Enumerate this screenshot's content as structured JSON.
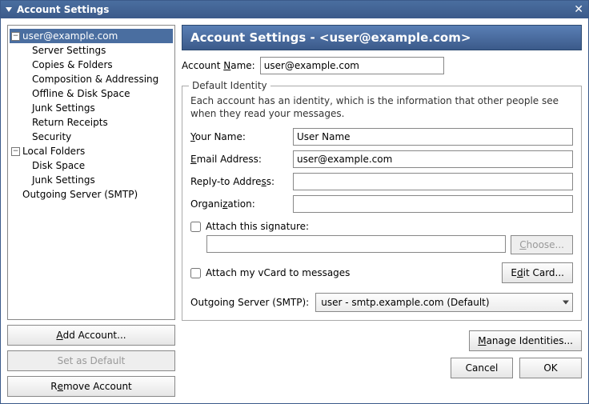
{
  "window": {
    "title": "Account Settings"
  },
  "tree": {
    "account": {
      "label": "user@example.com",
      "children": [
        "Server Settings",
        "Copies & Folders",
        "Composition & Addressing",
        "Offline & Disk Space",
        "Junk Settings",
        "Return Receipts",
        "Security"
      ]
    },
    "local": {
      "label": "Local Folders",
      "children": [
        "Disk Space",
        "Junk Settings"
      ]
    },
    "smtp": "Outgoing Server (SMTP)"
  },
  "left_buttons": {
    "add": {
      "pre": "",
      "mn": "A",
      "post": "dd Account..."
    },
    "default": "Set as Default",
    "remove": {
      "pre": "R",
      "mn": "e",
      "post": "move Account"
    }
  },
  "panel": {
    "title_prefix": "Account Settings - ",
    "title_account": "<user@example.com>",
    "account_name_label": {
      "pre": "Account ",
      "mn": "N",
      "post": "ame:"
    },
    "account_name_value": "user@example.com"
  },
  "identity": {
    "legend": "Default Identity",
    "desc": "Each account has an identity, which is the information that other people see when they read your messages.",
    "your_name": {
      "label": {
        "pre": "",
        "mn": "Y",
        "post": "our Name:"
      },
      "value": "User Name"
    },
    "email": {
      "label": {
        "pre": "",
        "mn": "E",
        "post": "mail Address:"
      },
      "value": "user@example.com"
    },
    "reply_to": {
      "label": {
        "pre": "Reply-to Addre",
        "mn": "s",
        "post": "s:"
      },
      "value": ""
    },
    "organization": {
      "label": {
        "pre": "Organi",
        "mn": "z",
        "post": "ation:"
      },
      "value": ""
    },
    "attach_sig": {
      "pre": "Attach this si",
      "mn": "g",
      "post": "nature:"
    },
    "sig_path": "",
    "choose": {
      "pre": "",
      "mn": "C",
      "post": "hoose..."
    },
    "attach_vcard": {
      "pre": "Attach my ",
      "mn": "v",
      "post": "Card to messages"
    },
    "edit_card": {
      "pre": "E",
      "mn": "d",
      "post": "it Card..."
    },
    "smtp_label": {
      "pre": "O",
      "mn": "u",
      "post": "tgoing Server (SMTP):"
    },
    "smtp_value": "user - smtp.example.com (Default)"
  },
  "manage": {
    "pre": "",
    "mn": "M",
    "post": "anage Identities..."
  },
  "footer": {
    "cancel": "Cancel",
    "ok": "OK"
  }
}
